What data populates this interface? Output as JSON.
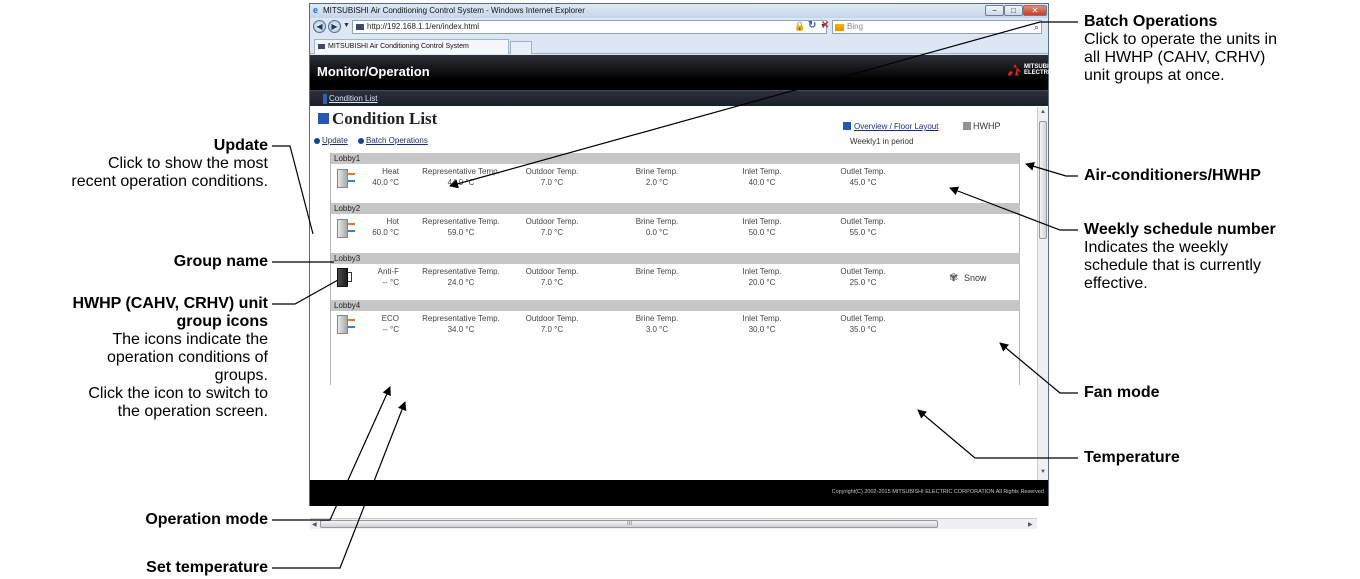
{
  "browser": {
    "window_title": "MITSUBISHI Air Conditioning Control System - Windows Internet Explorer",
    "url": "http://192.168.1.1/en/index.html",
    "search_placeholder": "Bing",
    "tab_title": "MITSUBISHI Air Conditioning Control System",
    "win_min": "−",
    "win_max": "□",
    "win_close": "✕"
  },
  "page": {
    "header_title": "Monitor/Operation",
    "logo_text": "MITSUBISHI ELECTRIC",
    "breadcrumb": "Condition List",
    "heading": "Condition List",
    "update_link": "Update",
    "batch_link": "Batch Operations",
    "overview_link": "Overview / Floor Layout",
    "hwhp_label": "HWHP",
    "weekly_status": "Weekly1 in period",
    "copyright": "Copyright(C) 2002-2015 MITSUBISHI ELECTRIC CORPORATION All Rights Reserved",
    "hscroll_grip": "III"
  },
  "groups": [
    {
      "name": "Lobby1",
      "mode": "Heat",
      "set_temp": "40.0 °C",
      "labels": [
        "Representative Temp.",
        "Outdoor Temp.",
        "Brine Temp.",
        "Inlet Temp.",
        "Outlet Temp."
      ],
      "values": [
        "44.0 °C",
        "7.0 °C",
        "2.0 °C",
        "40.0 °C",
        "45.0 °C"
      ]
    },
    {
      "name": "Lobby2",
      "mode": "Hot",
      "set_temp": "60.0 °C",
      "labels": [
        "Representative Temp.",
        "Outdoor Temp.",
        "Brine Temp.",
        "Inlet Temp.",
        "Outlet Temp."
      ],
      "values": [
        "59.0 °C",
        "7.0 °C",
        "0.0 °C",
        "50.0 °C",
        "55.0 °C"
      ]
    },
    {
      "name": "Lobby3",
      "mode": "Anti-F",
      "set_temp": "-- °C",
      "labels": [
        "Representative Temp.",
        "Outdoor Temp.",
        "Brine Temp.",
        "Inlet Temp.",
        "Outlet Temp."
      ],
      "values": [
        "24.0 °C",
        "7.0 °C",
        "",
        "20.0 °C",
        "25.0 °C"
      ],
      "fan_mode": "Snow"
    },
    {
      "name": "Lobby4",
      "mode": "ECO",
      "set_temp": "-- °C",
      "labels": [
        "Representative Temp.",
        "Outdoor Temp.",
        "Brine Temp.",
        "Inlet Temp.",
        "Outlet Temp."
      ],
      "values": [
        "34.0 °C",
        "7.0 °C",
        "3.0 °C",
        "30.0 °C",
        "35.0 °C"
      ]
    }
  ],
  "callouts": {
    "update_title": "Update",
    "update_desc1": "Click to show the most",
    "update_desc2": "recent operation conditions.",
    "group_name": "Group name",
    "icons_title1": "HWHP (CAHV, CRHV) unit",
    "icons_title2": "group icons",
    "icons_desc1": "The icons indicate the",
    "icons_desc2": "operation conditions of",
    "icons_desc3": "groups.",
    "icons_desc4": "Click the icon to switch to",
    "icons_desc5": "the operation screen.",
    "operation_mode": "Operation mode",
    "set_temperature": "Set temperature",
    "batch_title": "Batch Operations",
    "batch_desc1": "Click to operate the units in",
    "batch_desc2": "all HWHP (CAHV, CRHV)",
    "batch_desc3": "unit groups at once.",
    "aircon_hwhp": "Air-conditioners/HWHP",
    "weekly_title": "Weekly schedule number",
    "weekly_desc1": "Indicates the weekly",
    "weekly_desc2": "schedule that is currently",
    "weekly_desc3": "effective.",
    "fan_mode": "Fan mode",
    "temperature": "Temperature"
  }
}
